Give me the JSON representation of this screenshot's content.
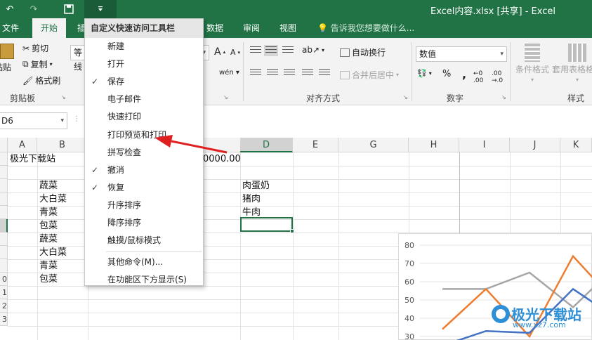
{
  "titlebar": {
    "title": "Excel内容.xlsx  [共享]  -  Excel",
    "undo_icon": "undo-icon",
    "redo_icon": "redo-icon",
    "save_icon": "save-icon",
    "customize_icon": "qat-dropdown-icon"
  },
  "tabs": [
    "文件",
    "开始",
    "插",
    "数据",
    "审阅",
    "视图"
  ],
  "tellme": "告诉我您想要做什么...",
  "ribbon": {
    "clipboard": {
      "paste": "粘贴",
      "cut": "剪切",
      "copy": "复制",
      "format_painter": "格式刷",
      "label": "剪贴板"
    },
    "font": {
      "name": "等线",
      "grow": "A",
      "shrink": "A"
    },
    "alignment": {
      "wrap": "自动换行",
      "merge": "合并后居中",
      "label": "对齐方式"
    },
    "number": {
      "format": "数值",
      "percent": "%",
      "comma": ",",
      "label": "数字"
    },
    "styles": {
      "conditional": "条件格式",
      "table_format": "套用表格格式",
      "label": "样式"
    }
  },
  "namebox": "D6",
  "columns": [
    "A",
    "B",
    "D",
    "E",
    "G",
    "H",
    "I",
    "J",
    "K"
  ],
  "rows": [
    "",
    "",
    "",
    "",
    "",
    "",
    "",
    "",
    "",
    "0",
    "1",
    "2",
    "3"
  ],
  "cells": {
    "a1": "极光下载站",
    "c1": "0000.00",
    "b3": "蔬菜",
    "b4": "大白菜",
    "b5": "青菜",
    "b6": "包菜",
    "b7": "蔬菜",
    "b8": "大白菜",
    "b9": "青菜",
    "b10": "包菜",
    "d3": "肉蛋奶",
    "d4": "猪肉",
    "d5": "牛肉"
  },
  "menu": {
    "header": "自定义快速访问工具栏",
    "items": [
      {
        "label": "新建",
        "checked": false
      },
      {
        "label": "打开",
        "checked": false
      },
      {
        "label": "保存",
        "checked": true
      },
      {
        "label": "电子邮件",
        "checked": false
      },
      {
        "label": "快速打印",
        "checked": false
      },
      {
        "label": "打印预览和打印",
        "checked": false
      },
      {
        "label": "拼写检查",
        "checked": false
      },
      {
        "label": "撤消",
        "checked": true
      },
      {
        "label": "恢复",
        "checked": true
      },
      {
        "label": "升序排序",
        "checked": false
      },
      {
        "label": "降序排序",
        "checked": false
      },
      {
        "label": "触摸/鼠标模式",
        "checked": false
      },
      {
        "label": "其他命令(M)...",
        "checked": false
      },
      {
        "label": "在功能区下方显示(S)",
        "checked": false
      }
    ],
    "check_glyph": "✓"
  },
  "chart_data": {
    "type": "line",
    "ylim": [
      30,
      80
    ],
    "yticks": [
      "80",
      "70",
      "60",
      "50",
      "40",
      "30"
    ],
    "series": [
      {
        "color": "#a5a5a5",
        "values": [
          56,
          56,
          65,
          46,
          69
        ]
      },
      {
        "color": "#ed7d31",
        "values": [
          34,
          56,
          30,
          74,
          48
        ]
      },
      {
        "color": "#4472c4",
        "values": [
          25,
          33,
          32,
          56,
          40
        ]
      }
    ]
  },
  "watermark": {
    "text": "极光下载站",
    "url": "www.xz7.com"
  },
  "colors": {
    "excel_green": "#217346",
    "arrow_red": "#e02020"
  }
}
